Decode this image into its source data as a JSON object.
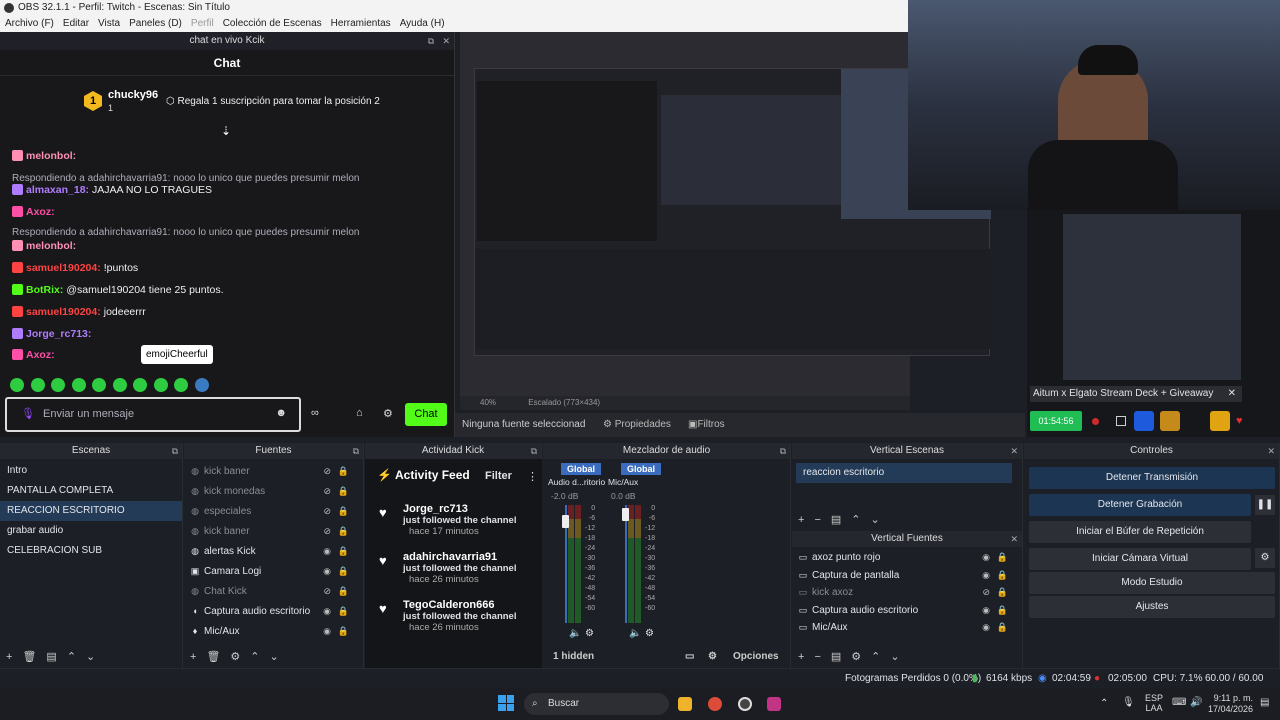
{
  "window": {
    "title": "OBS 32.1.1 - Perfil: Twitch - Escenas: Sin Título"
  },
  "menu": [
    "Archivo (F)",
    "Editar",
    "Vista",
    "Paneles (D)",
    "Perfil",
    "Colección de Escenas",
    "Herramientas",
    "Ayuda (H)"
  ],
  "chat_dock": {
    "header": "chat en vivo Kcik",
    "title": "Chat",
    "leader": {
      "rank": "1",
      "name": "chucky96",
      "count": "1",
      "promo": "Regala 1 suscripción para tomar la posición 2"
    },
    "messages": [
      {
        "user": "melonbol:",
        "text": "",
        "color": "#ff8fb3",
        "reply": ""
      },
      {
        "user": "",
        "text": "",
        "color": "",
        "reply": "Respondiendo a adahirchavarria91: nooo lo unico que puedes presumir melon"
      },
      {
        "user": "almaxan_18:",
        "text": "JAJAA NO LO TRAGUES",
        "color": "#b07cff",
        "reply": ""
      },
      {
        "user": "Axoz:",
        "text": "",
        "color": "#ff4fa7",
        "reply": ""
      },
      {
        "user": "",
        "text": "",
        "color": "",
        "reply": "Respondiendo a adahirchavarria91: nooo lo unico que puedes presumir melon"
      },
      {
        "user": "melonbol:",
        "text": "",
        "color": "#ff8fb3",
        "reply": ""
      },
      {
        "user": "samuel190204:",
        "text": "!puntos",
        "color": "#ff4242",
        "reply": ""
      },
      {
        "user": "BotRix:",
        "text": "@samuel190204 tiene 25 puntos.",
        "color": "#53fc18",
        "reply": ""
      },
      {
        "user": "samuel190204:",
        "text": "jodeeerrr",
        "color": "#ff4242",
        "reply": ""
      },
      {
        "user": "Jorge_rc713:",
        "text": "",
        "color": "#b07cff",
        "reply": ""
      },
      {
        "user": "Axoz:",
        "text": "",
        "color": "#ff4fa7",
        "reply": ""
      }
    ],
    "tooltip": "emojiCheerful",
    "input_placeholder": "Enviar un mensaje",
    "send_label": "Chat"
  },
  "preview": {
    "zoom": "40%",
    "scale": "Escalado (773×434)",
    "no_source": "Ninguna fuente seleccionad",
    "properties": "Propiedades",
    "filters": "Filtros"
  },
  "right_panel": {
    "giveaway": "Aitum x Elgato Stream Deck + Giveaway",
    "timer": "01:54:56"
  },
  "scenes": {
    "title": "Escenas",
    "items": [
      "Intro",
      "PANTALLA COMPLETA",
      "REACCION ESCRITORIO",
      "grabar audio",
      "CELEBRACION SUB"
    ],
    "selected": 2
  },
  "sources": {
    "title": "Fuentes",
    "items": [
      {
        "name": "kick baner",
        "icon": "globe-icon",
        "dim": true
      },
      {
        "name": "kick monedas",
        "icon": "globe-icon",
        "dim": true
      },
      {
        "name": "especiales",
        "icon": "globe-icon",
        "dim": true
      },
      {
        "name": "kick baner",
        "icon": "globe-icon",
        "dim": true
      },
      {
        "name": "alertas Kick",
        "icon": "globe-icon",
        "dim": false
      },
      {
        "name": "Camara Logi",
        "icon": "camera-icon",
        "dim": false
      },
      {
        "name": "Chat Kick",
        "icon": "globe-icon",
        "dim": true
      },
      {
        "name": "Captura audio escritorio",
        "icon": "speaker-icon",
        "dim": false
      },
      {
        "name": "Mic/Aux",
        "icon": "mic-icon",
        "dim": false
      }
    ]
  },
  "activity": {
    "dock_title": "Actividad Kick",
    "title": "Activity Feed",
    "filter": "Filter",
    "items": [
      {
        "name": "Jorge_rc713",
        "action": "just followed the channel",
        "time": "hace 17 minutos"
      },
      {
        "name": "adahirchavarria91",
        "action": "just followed the channel",
        "time": "hace 26 minutos"
      },
      {
        "name": "TegoCalderon666",
        "action": "just followed the channel",
        "time": "hace 26 minutos"
      }
    ]
  },
  "mixer": {
    "title": "Mezclador de audio",
    "channels": [
      {
        "tag": "Global",
        "name": "Audio d...ritorio",
        "db": "-2.0 dB"
      },
      {
        "tag": "Global",
        "name": "Mic/Aux",
        "db": "0.0 dB"
      }
    ],
    "ticks": [
      "0",
      "-6",
      "-12",
      "-18",
      "-24",
      "-30",
      "-36",
      "-42",
      "-48",
      "-54",
      "-60"
    ],
    "hidden": "1 hidden",
    "options": "Opciones"
  },
  "vertical_scenes": {
    "title": "Vertical Escenas",
    "items": [
      "reaccion escritorio"
    ]
  },
  "vertical_sources": {
    "title": "Vertical Fuentes",
    "items": [
      {
        "name": "axoz punto rojo",
        "dim": false
      },
      {
        "name": "Captura de pantalla",
        "dim": false
      },
      {
        "name": "kick axoz",
        "dim": true
      },
      {
        "name": "Captura audio escritorio",
        "dim": false
      },
      {
        "name": "Mic/Aux",
        "dim": false
      }
    ]
  },
  "controls": {
    "title": "Controles",
    "buttons": [
      "Detener Transmisión",
      "Detener Grabación",
      "Iniciar el Búfer de Repetición",
      "Iniciar Cámara Virtual",
      "Modo Estudio",
      "Ajustes"
    ]
  },
  "status": {
    "dropped": "Fotogramas Perdidos 0 (0.0%)",
    "bitrate": "6164 kbps",
    "stream_time": "02:04:59",
    "rec_time": "02:05:00",
    "cpu": "CPU: 7.1%",
    "fps": "60.00 / 60.00 FPS"
  },
  "taskbar": {
    "search": "Buscar",
    "lang": "ESP",
    "lang2": "LAA",
    "time": "9:11 p. m.",
    "date": "17/04/2026"
  }
}
